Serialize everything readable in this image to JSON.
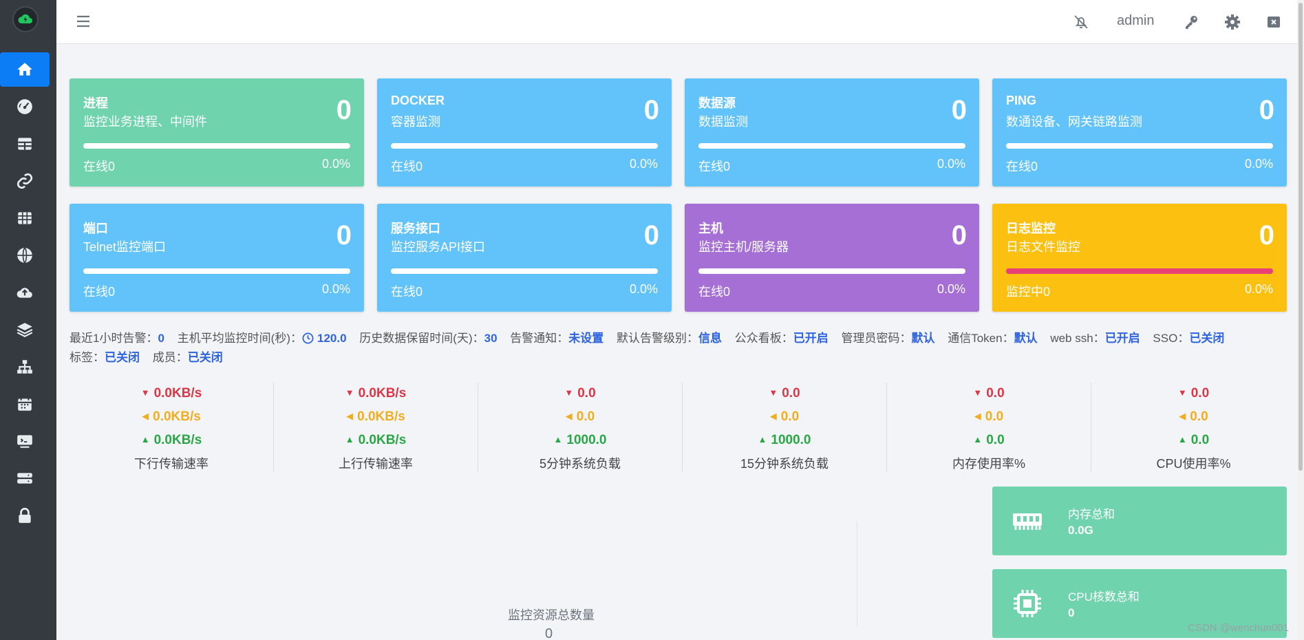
{
  "header": {
    "user": "admin"
  },
  "cards": [
    {
      "title": "进程",
      "subtitle": "监控业务进程、中间件",
      "count": "0",
      "online": "在线0",
      "percent": "0.0%",
      "color": "#6fd3ae",
      "bar_fill": 0,
      "bar_color": "#ffffff"
    },
    {
      "title": "DOCKER",
      "subtitle": "容器监测",
      "count": "0",
      "online": "在线0",
      "percent": "0.0%",
      "color": "#62c3fb",
      "bar_fill": 0,
      "bar_color": "#ffffff"
    },
    {
      "title": "数据源",
      "subtitle": "数据监测",
      "count": "0",
      "online": "在线0",
      "percent": "0.0%",
      "color": "#62c3fb",
      "bar_fill": 0,
      "bar_color": "#ffffff"
    },
    {
      "title": "PING",
      "subtitle": "数通设备、网关链路监测",
      "count": "0",
      "online": "在线0",
      "percent": "0.0%",
      "color": "#62c3fb",
      "bar_fill": 0,
      "bar_color": "#ffffff"
    },
    {
      "title": "端口",
      "subtitle": "Telnet监控端口",
      "count": "0",
      "online": "在线0",
      "percent": "0.0%",
      "color": "#62c3fb",
      "bar_fill": 0,
      "bar_color": "#ffffff"
    },
    {
      "title": "服务接口",
      "subtitle": "监控服务API接口",
      "count": "0",
      "online": "在线0",
      "percent": "0.0%",
      "color": "#62c3fb",
      "bar_fill": 0,
      "bar_color": "#ffffff"
    },
    {
      "title": "主机",
      "subtitle": "监控主机/服务器",
      "count": "0",
      "online": "在线0",
      "percent": "0.0%",
      "color": "#a66fd6",
      "bar_fill": 0,
      "bar_color": "#ffffff"
    },
    {
      "title": "日志监控",
      "subtitle": "日志文件监控",
      "count": "0",
      "online": "监控中0",
      "percent": "0.0%",
      "color": "#fcc011",
      "bar_fill": 1,
      "bar_color": "#e74177"
    }
  ],
  "status": {
    "alerts_label": "最近1小时告警：",
    "alerts_value": "0",
    "interval_label": "主机平均监控时间(秒)：",
    "interval_value": "120.0",
    "retention_label": "历史数据保留时间(天)：",
    "retention_value": "30",
    "notify_label": "告警通知：",
    "notify_value": "未设置",
    "level_label": "默认告警级别：",
    "level_value": "信息",
    "board_label": "公众看板：",
    "board_value": "已开启",
    "pwd_label": "管理员密码：",
    "pwd_value": "默认",
    "token_label": "通信Token：",
    "token_value": "默认",
    "ssh_label": "web ssh：",
    "ssh_value": "已开启",
    "sso_label": "SSO：",
    "sso_value": "已关闭",
    "tag_label": "标签：",
    "tag_value": "已关闭",
    "member_label": "成员：",
    "member_value": "已关闭"
  },
  "metrics": [
    {
      "down": "0.0KB/s",
      "flat": "0.0KB/s",
      "up": "0.0KB/s",
      "label": "下行传输速率"
    },
    {
      "down": "0.0KB/s",
      "flat": "0.0KB/s",
      "up": "0.0KB/s",
      "label": "上行传输速率"
    },
    {
      "down": "0.0",
      "flat": "0.0",
      "up": "1000.0",
      "label": "5分钟系统负载"
    },
    {
      "down": "0.0",
      "flat": "0.0",
      "up": "1000.0",
      "label": "15分钟系统负载"
    },
    {
      "down": "0.0",
      "flat": "0.0",
      "up": "0.0",
      "label": "内存使用率%"
    },
    {
      "down": "0.0",
      "flat": "0.0",
      "up": "0.0",
      "label": "CPU使用率%"
    }
  ],
  "resources": {
    "memory_label": "内存总和",
    "memory_value": "0.0G",
    "cpu_label": "CPU核数总和",
    "cpu_value": "0"
  },
  "total": {
    "label": "监控资源总数量",
    "value": "0"
  },
  "watermark": "CSDN @wenchun001"
}
